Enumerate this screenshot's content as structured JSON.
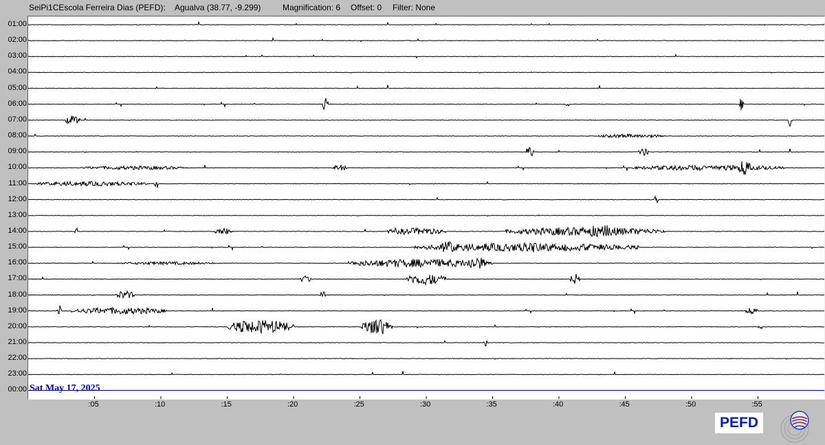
{
  "header": {
    "station": "SeiPi1CEscola Ferreira Dias (PEFD):",
    "location": "Agualva (38.77, -9.299)",
    "magnification": "Magnification: 6",
    "offset": "Offset: 0",
    "filter": "Filter: None"
  },
  "chart_data": {
    "type": "line",
    "title": "",
    "date": "Sat May 17, 2025",
    "row_labels": [
      "01:00",
      "02:00",
      "03:00",
      "04:00",
      "05:00",
      "06:00",
      "07:00",
      "08:00",
      "09:00",
      "10:00",
      "11:00",
      "12:00",
      "13:00",
      "14:00",
      "15:00",
      "16:00",
      "17:00",
      "18:00",
      "19:00",
      "20:00",
      "21:00",
      "22:00",
      "23:00",
      "00:00"
    ],
    "x_tick_labels": [
      ":05",
      ":10",
      ":15",
      ":20",
      ":25",
      ":30",
      ":35",
      ":40",
      ":45",
      ":50",
      ":55"
    ],
    "x_ticks_minutes": [
      5,
      10,
      15,
      20,
      25,
      30,
      35,
      40,
      45,
      50,
      55
    ],
    "xlim_minutes": [
      0,
      60
    ],
    "trace_color": "#000000",
    "current_row_color": "#0000cc",
    "activity": [
      {
        "row": "06:00",
        "start_min": 22.2,
        "end_min": 22.6,
        "level": 0.9
      },
      {
        "row": "06:00",
        "start_min": 40.5,
        "end_min": 40.8,
        "level": 0.4
      },
      {
        "row": "06:00",
        "start_min": 53.6,
        "end_min": 53.9,
        "level": 0.8
      },
      {
        "row": "07:00",
        "start_min": 2.8,
        "end_min": 3.9,
        "level": 0.6
      },
      {
        "row": "07:00",
        "start_min": 57.3,
        "end_min": 57.6,
        "level": 1.0
      },
      {
        "row": "08:00",
        "start_min": 43.0,
        "end_min": 48.0,
        "level": 0.25
      },
      {
        "row": "09:00",
        "start_min": 37.5,
        "end_min": 38.1,
        "level": 0.7
      },
      {
        "row": "09:00",
        "start_min": 46.0,
        "end_min": 46.8,
        "level": 0.5
      },
      {
        "row": "10:00",
        "start_min": 4.0,
        "end_min": 12.0,
        "level": 0.25
      },
      {
        "row": "10:00",
        "start_min": 23.0,
        "end_min": 24.0,
        "level": 0.4
      },
      {
        "row": "10:00",
        "start_min": 45.5,
        "end_min": 57.0,
        "level": 0.35
      },
      {
        "row": "10:00",
        "start_min": 53.5,
        "end_min": 54.5,
        "level": 1.0
      },
      {
        "row": "11:00",
        "start_min": 0.5,
        "end_min": 9.0,
        "level": 0.3
      },
      {
        "row": "11:00",
        "start_min": 9.5,
        "end_min": 9.8,
        "level": 0.9
      },
      {
        "row": "12:00",
        "start_min": 47.2,
        "end_min": 47.5,
        "level": 0.6
      },
      {
        "row": "14:00",
        "start_min": 3.5,
        "end_min": 3.7,
        "level": 0.8
      },
      {
        "row": "14:00",
        "start_min": 14.0,
        "end_min": 15.5,
        "level": 0.4
      },
      {
        "row": "14:00",
        "start_min": 27.0,
        "end_min": 31.5,
        "level": 0.45
      },
      {
        "row": "14:00",
        "start_min": 36.0,
        "end_min": 48.0,
        "level": 0.55
      },
      {
        "row": "14:00",
        "start_min": 42.0,
        "end_min": 44.5,
        "level": 0.9
      },
      {
        "row": "15:00",
        "start_min": 29.0,
        "end_min": 46.0,
        "level": 0.55
      },
      {
        "row": "15:00",
        "start_min": 31.0,
        "end_min": 32.5,
        "level": 0.8
      },
      {
        "row": "15:00",
        "start_min": 37.0,
        "end_min": 38.5,
        "level": 0.8
      },
      {
        "row": "16:00",
        "start_min": 7.0,
        "end_min": 14.0,
        "level": 0.2
      },
      {
        "row": "16:00",
        "start_min": 24.0,
        "end_min": 35.0,
        "level": 0.55
      },
      {
        "row": "16:00",
        "start_min": 33.0,
        "end_min": 34.5,
        "level": 0.9
      },
      {
        "row": "17:00",
        "start_min": 20.5,
        "end_min": 21.3,
        "level": 0.5
      },
      {
        "row": "17:00",
        "start_min": 28.5,
        "end_min": 31.5,
        "level": 0.75
      },
      {
        "row": "17:00",
        "start_min": 40.8,
        "end_min": 41.6,
        "level": 0.7
      },
      {
        "row": "18:00",
        "start_min": 6.5,
        "end_min": 8.0,
        "level": 0.55
      },
      {
        "row": "18:00",
        "start_min": 22.0,
        "end_min": 22.4,
        "level": 0.5
      },
      {
        "row": "19:00",
        "start_min": 2.2,
        "end_min": 2.5,
        "level": 0.8
      },
      {
        "row": "19:00",
        "start_min": 3.2,
        "end_min": 10.5,
        "level": 0.45
      },
      {
        "row": "19:00",
        "start_min": 54.0,
        "end_min": 55.0,
        "level": 0.4
      },
      {
        "row": "20:00",
        "start_min": 15.0,
        "end_min": 20.0,
        "level": 0.9
      },
      {
        "row": "20:00",
        "start_min": 25.0,
        "end_min": 27.5,
        "level": 1.0
      },
      {
        "row": "20:00",
        "start_min": 55.0,
        "end_min": 55.3,
        "level": 0.5
      },
      {
        "row": "21:00",
        "start_min": 34.3,
        "end_min": 34.6,
        "level": 0.5
      }
    ]
  },
  "logo": {
    "text": "PEFD",
    "seal_icon": "seal-icon"
  }
}
